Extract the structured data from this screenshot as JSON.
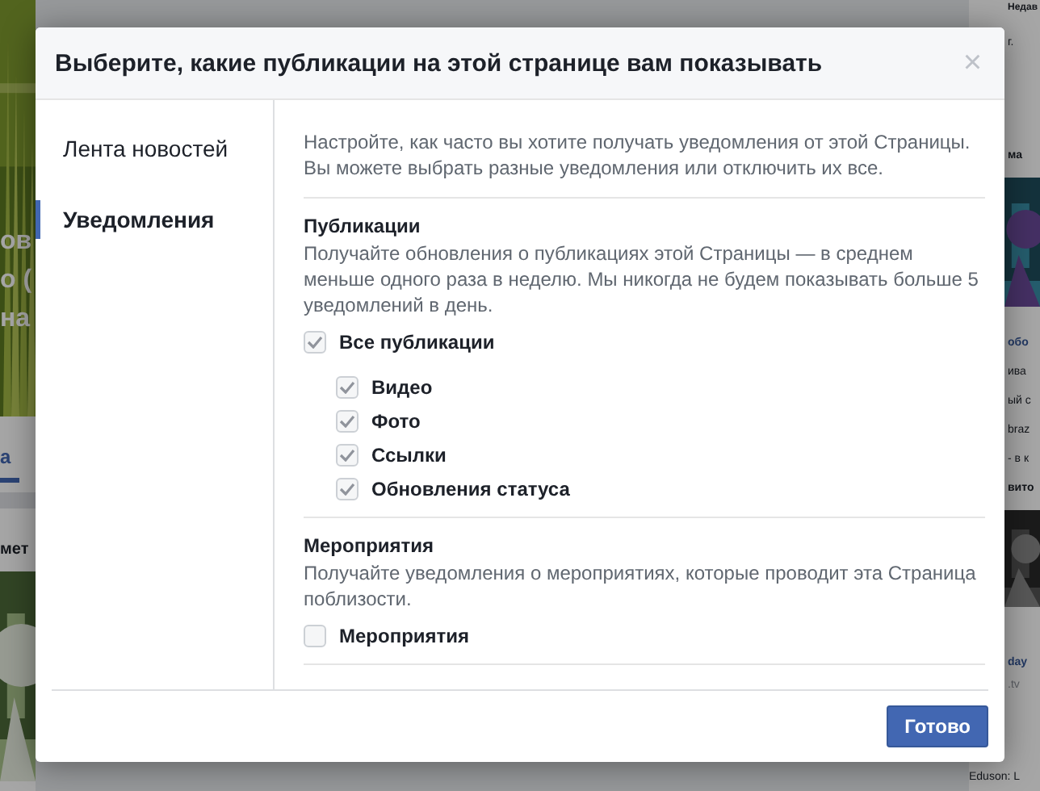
{
  "background": {
    "cover_texts": [
      "ов",
      "о (",
      "на"
    ],
    "left_tab": {
      "label": "а",
      "selected": true
    },
    "left_heading": "мет",
    "right_top": [
      "Недав",
      "г."
    ],
    "right_heading": "ма",
    "right_post": {
      "title": "обо",
      "lines": [
        "ива",
        "ый с",
        "braz",
        "- в к"
      ]
    },
    "right_heading_2": "вито",
    "right_ad": {
      "title": "day",
      "source": ".tv",
      "caption": "Eduson: L"
    }
  },
  "dialog": {
    "title": "Выберите, какие публикации на этой странице вам показывать",
    "close": "×",
    "nav": [
      {
        "label": "Лента новостей",
        "selected": false
      },
      {
        "label": "Уведомления",
        "selected": true
      }
    ],
    "intro": "Настройте, как часто вы хотите получать уведомления от этой Страницы. Вы можете выбрать разные уведомления или отключить их все.",
    "sections": [
      {
        "title": "Публикации",
        "description": "Получайте обновления о публикациях этой Страницы — в среднем меньше одного раза в неделю. Мы никогда не будем показывать больше 5 уведомлений в день.",
        "options": [
          {
            "label": "Все публикации",
            "checked": true,
            "children": [
              {
                "label": "Видео",
                "checked": true
              },
              {
                "label": "Фото",
                "checked": true
              },
              {
                "label": "Ссылки",
                "checked": true
              },
              {
                "label": "Обновления статуса",
                "checked": true
              }
            ]
          }
        ]
      },
      {
        "title": "Мероприятия",
        "description": "Получайте уведомления о мероприятиях, которые проводит эта Страница поблизости.",
        "options": [
          {
            "label": "Мероприятия",
            "checked": false
          }
        ]
      }
    ],
    "done_button": "Готово"
  }
}
